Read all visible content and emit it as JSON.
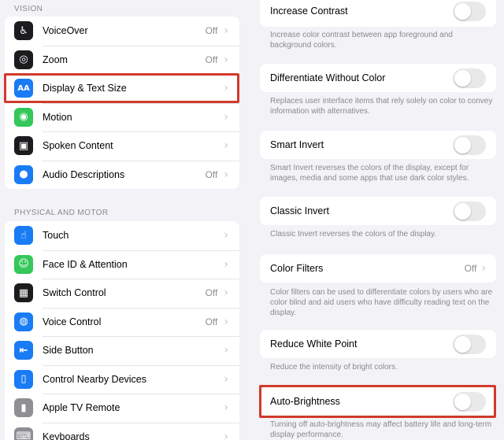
{
  "left_pane": {
    "vision": {
      "header": "VISION",
      "items": [
        {
          "label": "VoiceOver",
          "value": "Off",
          "icon": "voiceover-icon",
          "color": "#1c1c1e",
          "glyph": "♿"
        },
        {
          "label": "Zoom",
          "value": "Off",
          "icon": "zoom-icon",
          "color": "#1c1c1e",
          "glyph": "◎"
        },
        {
          "label": "Display & Text Size",
          "value": "",
          "icon": "text-size-icon",
          "color": "#1a7cf5",
          "glyph": "AA"
        },
        {
          "label": "Motion",
          "value": "",
          "icon": "motion-icon",
          "color": "#34c759",
          "glyph": "◉"
        },
        {
          "label": "Spoken Content",
          "value": "",
          "icon": "spoken-content-icon",
          "color": "#1c1c1e",
          "glyph": "▣"
        },
        {
          "label": "Audio Descriptions",
          "value": "Off",
          "icon": "audio-descriptions-icon",
          "color": "#1a7cf5",
          "glyph": "●"
        }
      ]
    },
    "physical": {
      "header": "PHYSICAL AND MOTOR",
      "items": [
        {
          "label": "Touch",
          "value": "",
          "icon": "touch-icon",
          "color": "#1a7cf5",
          "glyph": "☝"
        },
        {
          "label": "Face ID & Attention",
          "value": "",
          "icon": "face-id-icon",
          "color": "#34c759",
          "glyph": "☺"
        },
        {
          "label": "Switch Control",
          "value": "Off",
          "icon": "switch-control-icon",
          "color": "#1c1c1e",
          "glyph": "▦"
        },
        {
          "label": "Voice Control",
          "value": "Off",
          "icon": "voice-control-icon",
          "color": "#1a7cf5",
          "glyph": "◍"
        },
        {
          "label": "Side Button",
          "value": "",
          "icon": "side-button-icon",
          "color": "#1a7cf5",
          "glyph": "⇤"
        },
        {
          "label": "Control Nearby Devices",
          "value": "",
          "icon": "nearby-devices-icon",
          "color": "#1a7cf5",
          "glyph": "▯"
        },
        {
          "label": "Apple TV Remote",
          "value": "",
          "icon": "tv-remote-icon",
          "color": "#8e8e93",
          "glyph": "▮"
        },
        {
          "label": "Keyboards",
          "value": "",
          "icon": "keyboard-icon",
          "color": "#8e8e93",
          "glyph": "⌨"
        }
      ]
    }
  },
  "right_pane": {
    "settings": [
      {
        "label": "Increase Contrast",
        "control": "toggle",
        "value": "",
        "footer": "Increase color contrast between app foreground and background colors."
      },
      {
        "label": "Differentiate Without Color",
        "control": "toggle",
        "value": "",
        "footer": "Replaces user interface items that rely solely on color to convey information with alternatives."
      },
      {
        "label": "Smart Invert",
        "control": "toggle",
        "value": "",
        "footer": "Smart Invert reverses the colors of the display, except for images, media and some apps that use dark color styles."
      },
      {
        "label": "Classic Invert",
        "control": "toggle",
        "value": "",
        "footer": "Classic Invert reverses the colors of the display."
      },
      {
        "label": "Color Filters",
        "control": "link",
        "value": "Off",
        "footer": "Color filters can be used to differentiate colors by users who are color blind and aid users who have difficulty reading text on the display."
      },
      {
        "label": "Reduce White Point",
        "control": "toggle",
        "value": "",
        "footer": "Reduce the intensity of bright colors."
      },
      {
        "label": "Auto-Brightness",
        "control": "toggle",
        "value": "",
        "footer": "Turning off auto-brightness may affect battery life and long-term display performance."
      }
    ]
  },
  "chevron": "›",
  "colors": {
    "highlight": "#d23a2a",
    "background": "#f2f2f7"
  }
}
